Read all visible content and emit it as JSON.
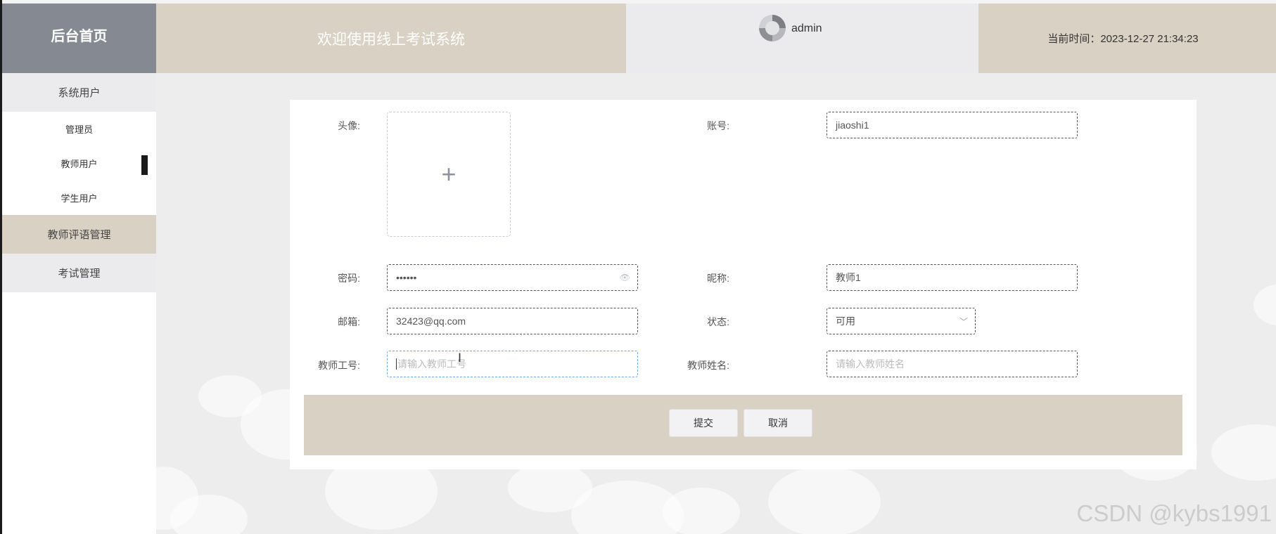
{
  "header": {
    "brand": "后台首页",
    "title": "欢迎使用线上考试系统",
    "username": "admin",
    "time": "当前时间：2023-12-27 21:34:23"
  },
  "sidebar": {
    "items": [
      {
        "label": "系统用户",
        "type": "group"
      },
      {
        "label": "管理员",
        "type": "sub"
      },
      {
        "label": "教师用户",
        "type": "sub",
        "active": true
      },
      {
        "label": "学生用户",
        "type": "sub"
      },
      {
        "label": "教师评语管理",
        "type": "group"
      },
      {
        "label": "考试管理",
        "type": "group"
      }
    ]
  },
  "form": {
    "avatar_label": "头像:",
    "avatar_plus": "+",
    "account_label": "账号:",
    "account_value": "jiaoshi1",
    "password_label": "密码:",
    "password_value": "••••••",
    "nickname_label": "昵称:",
    "nickname_value": "教师1",
    "email_label": "邮箱:",
    "email_value": "32423@qq.com",
    "status_label": "状态:",
    "status_value": "可用",
    "teacher_id_label": "教师工号:",
    "teacher_id_placeholder": "请输入教师工号",
    "teacher_name_label": "教师姓名:",
    "teacher_name_placeholder": "请输入教师姓名"
  },
  "actions": {
    "submit": "提交",
    "cancel": "取消"
  },
  "watermark": "CSDN @kybs1991",
  "icons": {
    "eye": "👁",
    "chevron": "﹀",
    "cursor": "I"
  }
}
